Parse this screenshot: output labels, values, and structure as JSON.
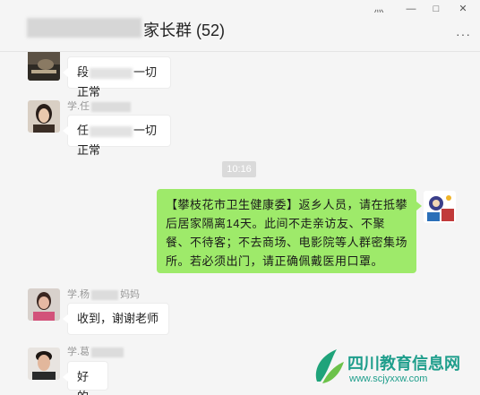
{
  "window": {
    "title": "家长群 (52)",
    "controls": {
      "pin": "⺣",
      "minimize": "—",
      "maximize": "□",
      "close": "✕"
    },
    "more": "···"
  },
  "messages": [
    {
      "prefix": "段",
      "suffix": "一切正常"
    },
    {
      "sender_prefix": "学.任",
      "prefix": "任",
      "suffix": "一切正常"
    },
    {
      "time": "10:16"
    },
    {
      "text": "【攀枝花市卫生健康委】返乡人员，请在抵攀后居家隔离14天。此间不走亲访友、不聚餐、不待客；不去商场、电影院等人群密集场所。若必须出门，请正确佩戴医用口罩。"
    },
    {
      "sender_prefix": "学.杨",
      "sender_suffix": "妈妈",
      "text": "收到，谢谢老师"
    },
    {
      "sender_prefix": "学.葛",
      "text": "好的"
    }
  ],
  "watermark": {
    "title": "四川教育信息网",
    "url": "www.scjyxxw.com"
  },
  "colors": {
    "bubble_self": "#9eea6a",
    "bubble_other": "#ffffff",
    "bg": "#f5f5f5",
    "watermark": "#1f9e8c"
  }
}
